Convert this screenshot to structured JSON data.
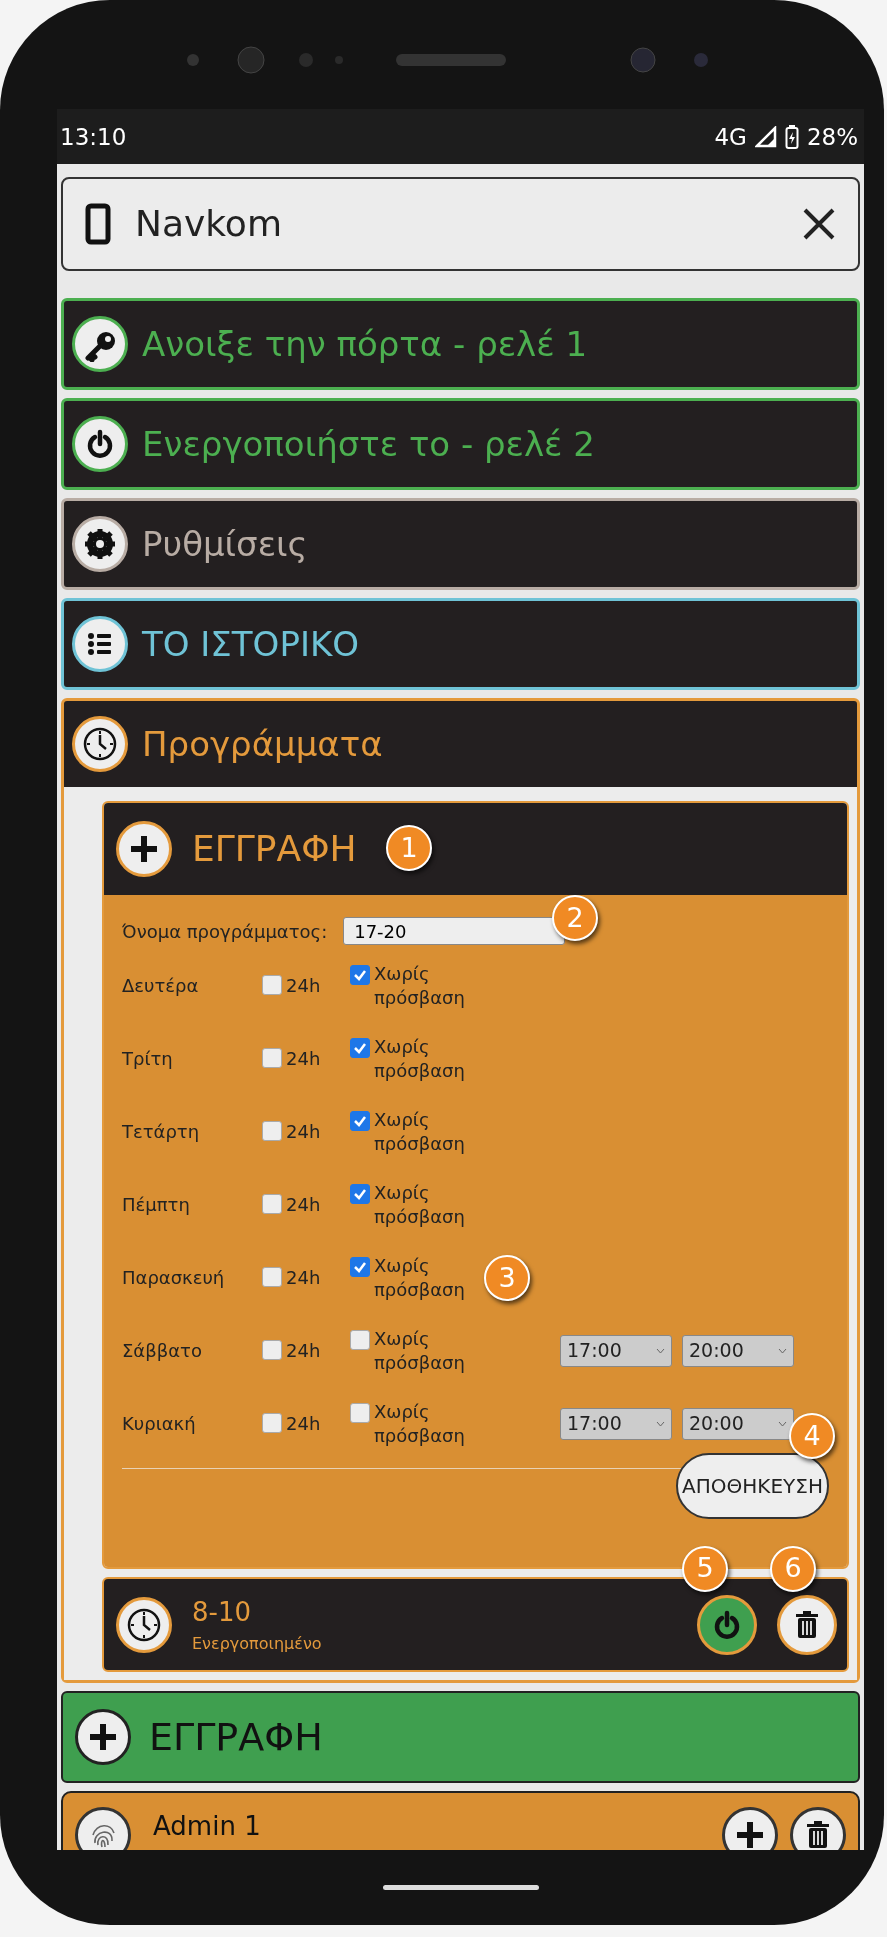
{
  "status_bar": {
    "time": "13:10",
    "network": "4G",
    "battery": "28%"
  },
  "header": {
    "title": "Navkom"
  },
  "menu": [
    {
      "label": "Ανοιξε την πόρτα - ρελέ 1",
      "kind": "key",
      "color": "#4caf50",
      "expanded": false
    },
    {
      "label": "Ενεργοποιήστε το - ρελέ 2",
      "kind": "power",
      "color": "#4caf50",
      "expanded": false
    },
    {
      "label": "Ρυθμίσεις",
      "kind": "gear",
      "color": "#b8aca4",
      "expanded": false
    },
    {
      "label": "ΤΟ ΙΣΤΟΡΙΚΟ",
      "kind": "list",
      "color": "#6fc3d6",
      "expanded": false
    },
    {
      "label": "Προγράμματα",
      "kind": "clock",
      "color": "#e49a3c",
      "expanded": true
    }
  ],
  "programs_panel": {
    "form": {
      "title": "ΕΓΓΡΑΦΗ",
      "name_label": "Όνομα προγράμματος:",
      "name_value": "17-20",
      "days": [
        {
          "name": "Δευτέρα",
          "h24": {
            "label": "24h",
            "checked": false
          },
          "no_access": {
            "label": "Χωρίς πρόσβαση",
            "checked": true
          }
        },
        {
          "name": "Τρίτη",
          "h24": {
            "label": "24h",
            "checked": false
          },
          "no_access": {
            "label": "Χωρίς πρόσβαση",
            "checked": true
          }
        },
        {
          "name": "Τετάρτη",
          "h24": {
            "label": "24h",
            "checked": false
          },
          "no_access": {
            "label": "Χωρίς πρόσβαση",
            "checked": true
          }
        },
        {
          "name": "Πέμπτη",
          "h24": {
            "label": "24h",
            "checked": false
          },
          "no_access": {
            "label": "Χωρίς πρόσβαση",
            "checked": true
          }
        },
        {
          "name": "Παρασκευή",
          "h24": {
            "label": "24h",
            "checked": false
          },
          "no_access": {
            "label": "Χωρίς πρόσβαση",
            "checked": true
          }
        },
        {
          "name": "Σάββατο",
          "h24": {
            "label": "24h",
            "checked": false
          },
          "no_access": {
            "label": "Χωρίς πρόσβαση",
            "checked": false
          },
          "from": "17:00",
          "to": "20:00"
        },
        {
          "name": "Κυριακή",
          "h24": {
            "label": "24h",
            "checked": false
          },
          "no_access": {
            "label": "Χωρίς πρόσβαση",
            "checked": false
          },
          "from": "17:00",
          "to": "20:00"
        }
      ],
      "save": "ΑΠΟΘΗΚΕΥΣΗ"
    },
    "schedules": [
      {
        "name": "8-10",
        "status": "Ενεργοποιημένο",
        "on": true
      }
    ]
  },
  "add_button": "ΕΓΓΡΑΦΗ",
  "users": [
    {
      "name": "Admin 1"
    }
  ],
  "callouts": [
    {
      "label": "1"
    },
    {
      "label": "2"
    },
    {
      "label": "3"
    },
    {
      "label": "4"
    },
    {
      "label": "5"
    },
    {
      "label": "6"
    }
  ]
}
